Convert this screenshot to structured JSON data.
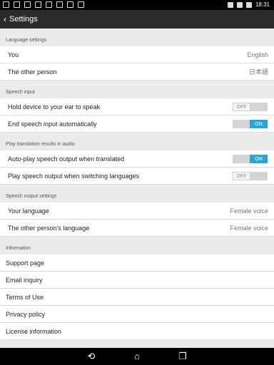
{
  "status_bar": {
    "time": "18:31",
    "left_icons": [
      "sim-icon",
      "photo-icon",
      "mail-icon",
      "shield-icon",
      "download-icon",
      "menu-icon",
      "download-icon",
      "pin-icon"
    ],
    "right_icons": [
      "alarm-icon",
      "wifi-icon",
      "battery-icon"
    ]
  },
  "app_bar": {
    "back_icon": "chevron-left-icon",
    "title": "Settings"
  },
  "sections": {
    "language": {
      "header": "Language settings",
      "you_label": "You",
      "you_value": "English",
      "other_label": "The other person",
      "other_value": "日本語"
    },
    "speech_input": {
      "header": "Speech input",
      "hold_label": "Hold device to your ear to speak",
      "hold_state": "OFF",
      "end_label": "End speech input automatically",
      "end_state": "ON"
    },
    "play_results": {
      "header": "Play translation results in audio",
      "autoplay_label": "Auto-play speech output when translated",
      "autoplay_state": "ON",
      "switch_label": "Play speech output when switching languages",
      "switch_state": "OFF"
    },
    "speech_output": {
      "header": "Speech output settings",
      "your_label": "Your language",
      "your_value": "Female voice",
      "other_label": "The other person's language",
      "other_value": "Female voice"
    },
    "information": {
      "header": "Information",
      "items": [
        "Support page",
        "Email inquiry",
        "Terms of Use",
        "Privacy policy",
        "License information"
      ]
    }
  },
  "nav_bar": {
    "back_icon": "back-icon",
    "home_icon": "home-icon",
    "recents_icon": "recents-icon"
  },
  "colors": {
    "accent": "#2aa6d6",
    "app_bar": "#2b2b2b",
    "background": "#ebebeb"
  }
}
